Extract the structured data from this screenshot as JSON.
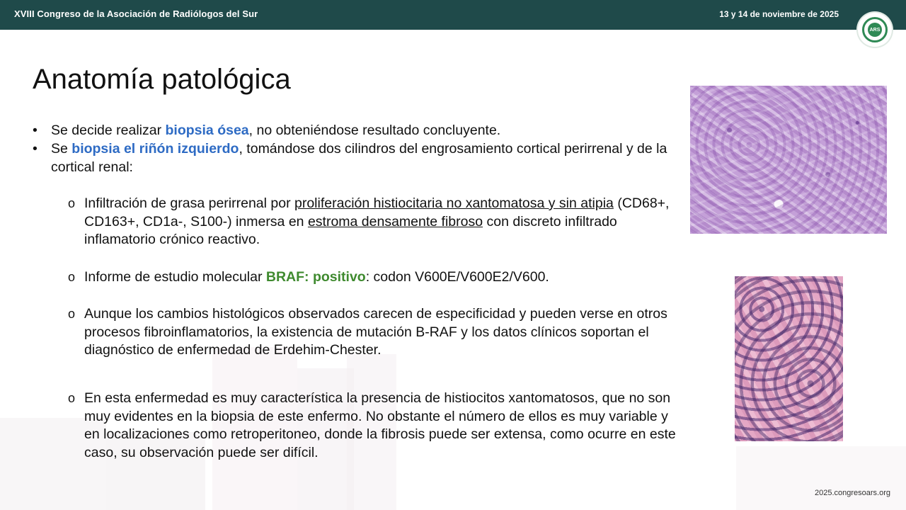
{
  "header": {
    "congress_title": "XVIII Congreso de la Asociación de Radiólogos del Sur",
    "date": "13 y 14 de noviembre de 2025",
    "logo_text": "ARS"
  },
  "slide": {
    "title": "Anatomía patológica",
    "bullets": [
      {
        "marker": "•",
        "pre": " Se decide realizar ",
        "highlight": "biopsia ósea",
        "post": ", no obteniéndose resultado concluyente."
      },
      {
        "marker": "•",
        "pre": " Se ",
        "highlight": "biopsia el riñón izquierdo",
        "post": ", tomándose dos cilindros del engrosamiento cortical perirrenal y de la cortical renal:"
      }
    ],
    "subbullets": {
      "marker": "o",
      "s1": {
        "t1": "Infiltración de grasa perirrenal por ",
        "u1": "proliferación histiocitaria no xantomatosa y sin atipia",
        "t2": " (CD68+, CD163+, CD1a-, S100-) inmersa en ",
        "u2": "estroma densamente fibroso",
        "t3": " con discreto infiltrado inflamatorio crónico reactivo."
      },
      "s2": {
        "t1": "Informe de estudio molecular ",
        "highlight": "BRAF: positivo",
        "t2": ": codon V600E/V600E2/V600."
      },
      "s3": {
        "text": "Aunque los cambios histológicos observados carecen de especificidad y pueden verse en otros procesos fibroinflamatorios, la existencia de mutación B-RAF y los datos clínicos soportan el diagnóstico de enfermedad de Erdehim-Chester."
      },
      "s4": {
        "text": "En esta enfermedad es muy característica la presencia de histiocitos xantomatosos, que no son muy evidentes en la biopsia de este enfermo. No obstante el número de ellos es muy variable y en localizaciones como retroperitoneo, donde la fibrosis puede ser extensa, como ocurre en este caso, su observación puede ser difícil."
      }
    }
  },
  "footer": {
    "url": "2025.congresoars.org"
  },
  "colors": {
    "header_bg": "#1f4a4a",
    "blue_highlight": "#2e6bc4",
    "green_highlight": "#3f8a2f",
    "logo_green": "#2f8a55"
  },
  "images": {
    "histology_1": "histology-image-purple",
    "histology_2": "histology-image-pink"
  }
}
